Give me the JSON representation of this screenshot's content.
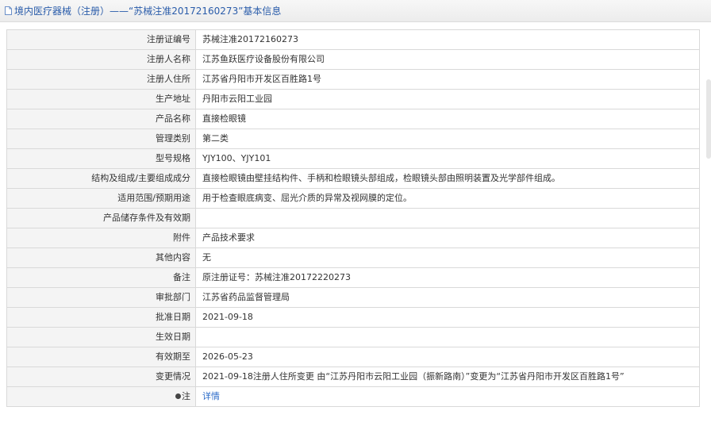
{
  "header": {
    "title": "境内医疗器械（注册）——“苏械注准20172160273”基本信息"
  },
  "rows": [
    {
      "label": "注册证编号",
      "value": "苏械注准20172160273"
    },
    {
      "label": "注册人名称",
      "value": "江苏鱼跃医疗设备股份有限公司"
    },
    {
      "label": "注册人住所",
      "value": "江苏省丹阳市开发区百胜路1号"
    },
    {
      "label": "生产地址",
      "value": "丹阳市云阳工业园"
    },
    {
      "label": "产品名称",
      "value": "直接检眼镜"
    },
    {
      "label": "管理类别",
      "value": "第二类"
    },
    {
      "label": "型号规格",
      "value": "YJY100、YJY101"
    },
    {
      "label": "结构及组成/主要组成成分",
      "value": "直接检眼镜由壁挂结构件、手柄和检眼镜头部组成，检眼镜头部由照明装置及光学部件组成。"
    },
    {
      "label": "适用范围/预期用途",
      "value": "用于检查眼底病变、屈光介质的异常及视网膜的定位。"
    },
    {
      "label": "产品储存条件及有效期",
      "value": ""
    },
    {
      "label": "附件",
      "value": "产品技术要求"
    },
    {
      "label": "其他内容",
      "value": "无"
    },
    {
      "label": "备注",
      "value": "原注册证号：苏械注准20172220273"
    },
    {
      "label": "审批部门",
      "value": "江苏省药品监督管理局"
    },
    {
      "label": "批准日期",
      "value": "2021-09-18"
    },
    {
      "label": "生效日期",
      "value": ""
    },
    {
      "label": "有效期至",
      "value": "2026-05-23"
    },
    {
      "label": "变更情况",
      "value": "2021-09-18注册人住所变更 由“江苏丹阳市云阳工业园（振新路南）”变更为“江苏省丹阳市开发区百胜路1号”"
    }
  ],
  "note_row": {
    "label": "注",
    "link": "详情"
  }
}
